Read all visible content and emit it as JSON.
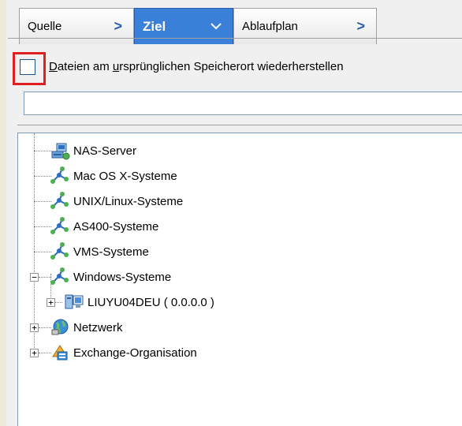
{
  "tabs": [
    {
      "label": "Quelle",
      "chevron": ">"
    },
    {
      "label": "Ziel",
      "chevron": "v",
      "active": true
    },
    {
      "label": "Ablaufplan",
      "chevron": ">"
    }
  ],
  "restore_option": {
    "label_pre": "",
    "label_accel": "D",
    "label_mid": "ateien am ",
    "label_accel2": "u",
    "label_post": "rsprünglichen Speicherort wiederherstellen",
    "checked": false
  },
  "path_field": {
    "value": ""
  },
  "tree": [
    {
      "label": "NAS-Server",
      "icon": "nas-server-icon"
    },
    {
      "label": "Mac OS X-Systeme",
      "icon": "network-node-icon"
    },
    {
      "label": "UNIX/Linux-Systeme",
      "icon": "network-node-icon"
    },
    {
      "label": "AS400-Systeme",
      "icon": "network-node-icon"
    },
    {
      "label": "VMS-Systeme",
      "icon": "network-node-icon"
    },
    {
      "label": "Windows-Systeme",
      "icon": "network-node-icon",
      "expander": "−"
    },
    {
      "label": "LIUYU04DEU ( 0.0.0.0 )",
      "icon": "computer-icon",
      "expander": "+"
    },
    {
      "label": "Netzwerk",
      "icon": "globe-icon",
      "expander": "+"
    },
    {
      "label": "Exchange-Organisation",
      "icon": "exchange-icon",
      "expander": "+"
    }
  ],
  "colors": {
    "active_tab": "#3a7fd8",
    "highlight": "#e02020"
  }
}
